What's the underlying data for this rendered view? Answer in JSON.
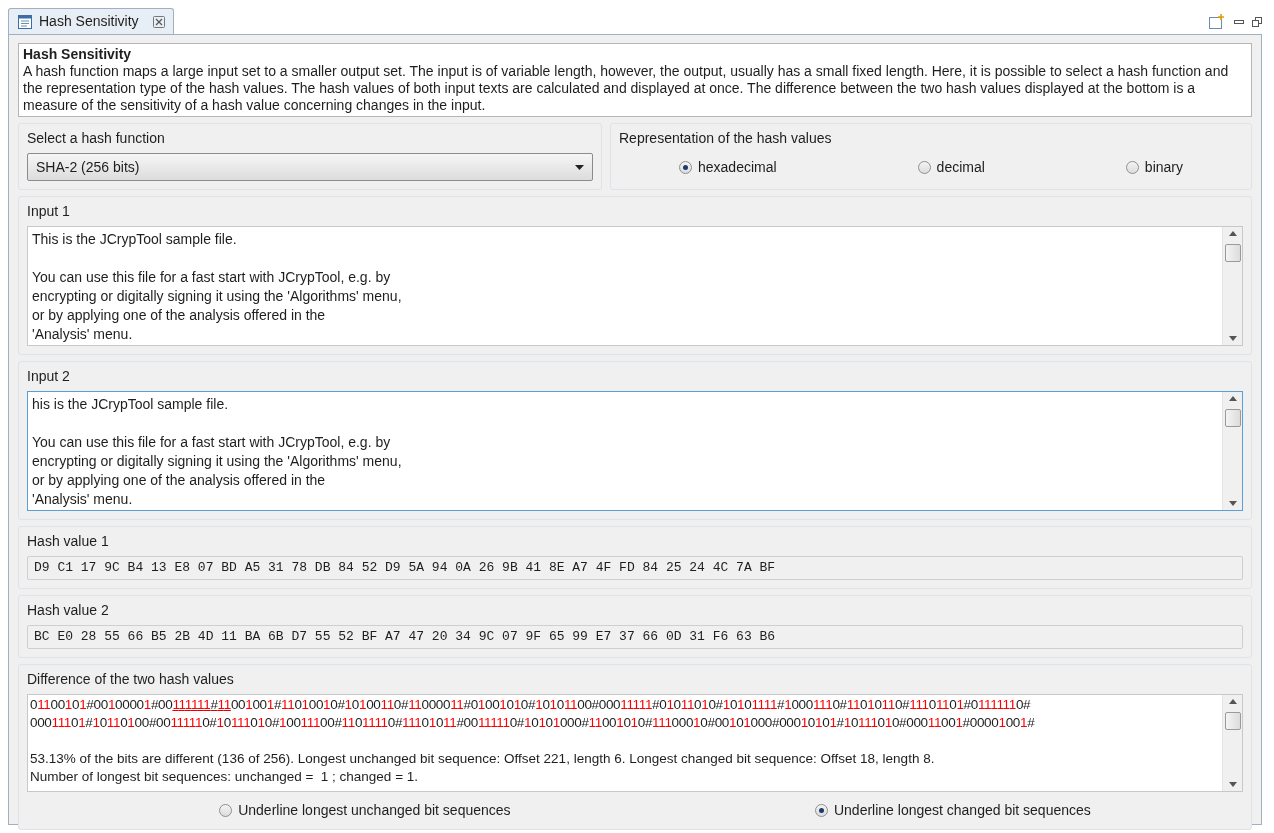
{
  "tab": {
    "label": "Hash Sensitivity",
    "selected": true
  },
  "description": {
    "title": "Hash Sensitivity",
    "text": "A hash function maps a large input set to a smaller output set. The input is of variable length, however, the output, usually has a small fixed length. Here, it is possible to select a hash function and the representation type of the hash values. The hash values of both input texts are calculated and displayed at once. The difference between the two hash values displayed at the bottom is a measure of the sensitivity of a hash value concerning changes in the input."
  },
  "hash_function": {
    "label": "Select a hash function",
    "value": "SHA-2 (256 bits)"
  },
  "representation": {
    "label": "Representation of the hash values",
    "options": [
      {
        "label": "hexadecimal",
        "selected": true
      },
      {
        "label": "decimal",
        "selected": false
      },
      {
        "label": "binary",
        "selected": false
      }
    ]
  },
  "inputs": [
    {
      "label": "Input 1",
      "focused": false,
      "paragraphs": [
        [
          "This is the JCrypTool sample file."
        ],
        [
          "You can use this file for a fast start with JCrypTool, e.g. by",
          "encrypting or digitally signing it using the 'Algorithms' menu,",
          "or by applying one of the analysis offered in the",
          "'Analysis' menu."
        ]
      ]
    },
    {
      "label": "Input 2",
      "focused": true,
      "paragraphs": [
        [
          "his is the JCrypTool sample file."
        ],
        [
          "You can use this file for a fast start with JCrypTool, e.g. by",
          "encrypting or digitally signing it using the 'Algorithms' menu,",
          "or by applying one of the analysis offered in the",
          "'Analysis' menu."
        ]
      ]
    }
  ],
  "hash_values": [
    {
      "label": "Hash value 1",
      "value": "D9 C1 17 9C B4 13 E8 07 BD A5 31 78 DB 84 52 D9 5A 94 0A 26 9B 41 8E A7 4F FD 84 25 24 4C 7A BF"
    },
    {
      "label": "Hash value 2",
      "value": "BC E0 28 55 66 B5 2B 4D 11 BA 6B D7 55 52 BF A7 47 20 34 9C 07 9F 65 99 E7 37 66 0D 31 F6 63 B6"
    }
  ],
  "difference": {
    "label": "Difference of the two hash values",
    "highlight_changed": true,
    "bit_lines": [
      [
        {
          "text": "01100101#00100001#00",
          "underlined": false
        },
        {
          "text": "111111#11",
          "underlined": true
        },
        {
          "text": "001001#11010010#10100110#11000011#01001010#10101100#00011111#01011010#10101111#10001110#11010110#11101101#01111110#",
          "underlined": false
        }
      ],
      [
        {
          "text": "00011101#10110100#00111110#10111010#10011100#11011110#11101011#00111110#10101000#11001010#11100010#00101000#00010101#10111010#00011001#00001001#",
          "underlined": false
        }
      ]
    ],
    "summary": [
      "53.13% of the bits are different (136 of 256). Longest unchanged bit sequence: Offset 221, length 6. Longest changed bit sequence: Offset 18, length 8.",
      "Number of longest bit sequences: unchanged =  1 ; changed = 1."
    ]
  },
  "underline_options": [
    {
      "label": "Underline longest unchanged bit sequences",
      "selected": false
    },
    {
      "label": "Underline longest changed bit sequences",
      "selected": true
    }
  ]
}
